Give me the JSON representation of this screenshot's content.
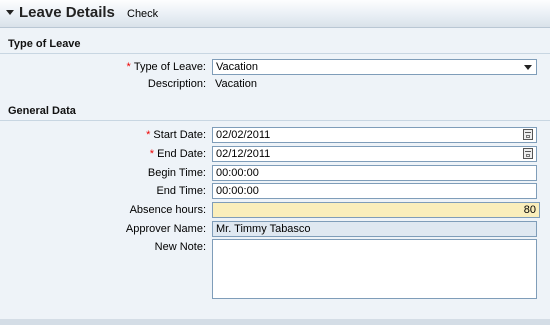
{
  "header": {
    "title": "Leave Details",
    "check_label": "Check"
  },
  "type_section": {
    "title": "Type of Leave",
    "type_label": "Type of Leave:",
    "type_value": "Vacation",
    "description_label": "Description:",
    "description_value": "Vacation"
  },
  "general_section": {
    "title": "General Data",
    "start_label": "Start Date:",
    "start_value": "02/02/2011",
    "end_label": "End Date:",
    "end_value": "02/12/2011",
    "begin_time_label": "Begin Time:",
    "begin_time_value": "00:00:00",
    "end_time_label": "End Time:",
    "end_time_value": "00:00:00",
    "hours_label": "Absence hours:",
    "hours_value": "80",
    "approver_label": "Approver Name:",
    "approver_value": "Mr. Timmy Tabasco",
    "note_label": "New Note:",
    "note_value": ""
  },
  "required_marker": "*",
  "icons": [
    "collapse-icon",
    "dropdown-arrow-icon",
    "calendar-icon"
  ]
}
